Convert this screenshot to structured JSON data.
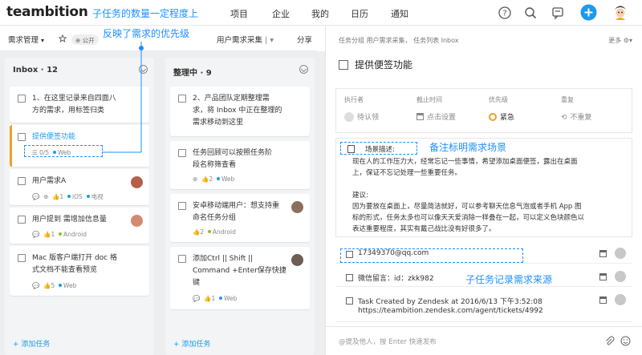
{
  "app": {
    "logo": "teambition"
  },
  "annotations": {
    "top": "子任务的数量一定程度上",
    "second": "反映了需求的优先级",
    "note_hint": "备注标明需求场景",
    "subtask_hint": "子任务记录需求来源"
  },
  "nav": [
    "项目",
    "企业",
    "我的",
    "日历",
    "通知"
  ],
  "projbar": {
    "project": "需求管理",
    "visibility": "公开",
    "view": "用户需求采集",
    "share": "分享"
  },
  "columns": [
    {
      "title": "Inbox · 12",
      "add_label": "+ 添加任务",
      "cards": [
        {
          "lines": [
            "1、在这里记录来自四面八",
            "方的需求，用标签归类"
          ],
          "meta": ""
        },
        {
          "lines": [
            "提供便签功能"
          ],
          "meta": "☰ 0/5  ● Web"
        },
        {
          "lines": [
            "用户需求A"
          ],
          "meta": "💬 ⊕ 👍1 ● iOS ● 电视"
        },
        {
          "lines": [
            "用户提到 需增加信息量"
          ],
          "meta": "💬 👍1 ● Android"
        },
        {
          "lines": [
            "Mac 版客户端打开 doc 格",
            "式文档不能查看预览"
          ],
          "meta": "💬 👍5 ● Web"
        }
      ]
    },
    {
      "title": "整理中 · 9",
      "add_label": "+ 添加任务",
      "cards": [
        {
          "lines": [
            "2、产品团队定期整理需",
            "求，将 Inbox 中正在整理的",
            "需求移动到这里"
          ],
          "meta": ""
        },
        {
          "lines": [
            "任务回顾可以按照任务阶",
            "段名称筛查看"
          ],
          "meta": "⊕ 👍2 ● Web"
        },
        {
          "lines": [
            "安卓移动端用户：想支持重",
            "命名任务分组"
          ],
          "meta": "👍2 ● Android"
        },
        {
          "lines": [
            "添加Ctrl || Shift ||",
            "Command +Enter保存快捷",
            "键"
          ],
          "meta": "💬 👍1 ● Web"
        }
      ]
    }
  ],
  "detail": {
    "breadcrumb": "任务分组 用户需求采集， 任务列表 Inbox",
    "more": "更多",
    "title": "提供便签功能",
    "props": [
      {
        "label": "执行者",
        "value": "待认领"
      },
      {
        "label": "截止时间",
        "value": "点击设置"
      },
      {
        "label": "优先级",
        "value": "紧急"
      },
      {
        "label": "重复",
        "value": "不重复"
      }
    ],
    "note": {
      "heading": "场景描述:",
      "lines": [
        "现在人的工作压力大，经常忘记一些事情，希望添加桌面便签，露出在桌面",
        "上，保证不忘记处理一些重要任务。",
        "",
        "建议:",
        "因为要放在桌面上，尽量简洁就好，可以参考聊天信息气泡或者手机 App 图",
        "标的形式，任务太多也可以像天天爱消除一样叠在一起，可以定义色块颜色以",
        "表达重要程度，其实有戴己战比没有好很多了。"
      ]
    },
    "subtasks": [
      {
        "text": "17349370@qq.com"
      },
      {
        "text": "微信留言：id：zkk982"
      },
      {
        "text": "Task Created by Zendesk at 2016/6/13 下午3:52:08",
        "text2": "https://teambition.zendesk.com/agent/tickets/4992"
      }
    ],
    "comment_placeholder": "@提及他人，按 Enter 快速发布"
  },
  "colors": {
    "accent": "#1b9aee",
    "annotation": "#1e90ff",
    "priority": "#f0a028",
    "web_dot": "#1b9aee",
    "ios_dot": "#1b9aee",
    "android_dot": "#8fc31f"
  }
}
